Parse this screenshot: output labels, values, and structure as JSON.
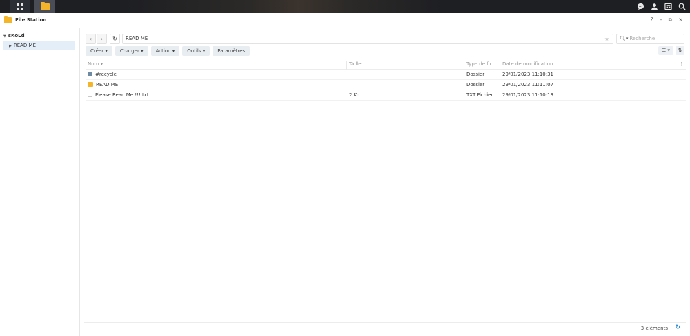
{
  "taskbar": {
    "main_menu_icon": "grid-icon",
    "file_station_icon": "folder-icon",
    "right_icons": [
      "chat-icon",
      "user-icon",
      "widgets-icon",
      "search-icon"
    ]
  },
  "window": {
    "title": "File Station",
    "controls": {
      "help": "?",
      "minimize": "–",
      "restore": "⧉",
      "close": "×"
    }
  },
  "sidebar": {
    "root_label": "sKoLd",
    "items": [
      {
        "label": "READ ME"
      }
    ]
  },
  "navigation": {
    "path": "READ ME",
    "search_placeholder": "Recherche"
  },
  "toolbar": {
    "create": "Créer",
    "upload": "Charger",
    "action": "Action",
    "tools": "Outils",
    "settings": "Paramètres"
  },
  "table": {
    "headers": {
      "name": "Nom",
      "size": "Taille",
      "type": "Type de fic...",
      "date": "Date de modification"
    },
    "rows": [
      {
        "icon": "trash-icon",
        "name": "#recycle",
        "size": "",
        "type": "Dossier",
        "date": "29/01/2023 11:10:31"
      },
      {
        "icon": "folder-icon",
        "name": "READ ME",
        "size": "",
        "type": "Dossier",
        "date": "29/01/2023 11:11:07"
      },
      {
        "icon": "text-file-icon",
        "name": "Please Read Me !!!.txt",
        "size": "2 Ko",
        "type": "TXT Fichier",
        "date": "29/01/2023 11:10:13"
      }
    ]
  },
  "status": {
    "count": "3 éléments"
  },
  "colors": {
    "accent": "#2b8ad6",
    "folder": "#f5b52a",
    "taskbar": "#1e1f23",
    "selection": "#e4eef8"
  }
}
